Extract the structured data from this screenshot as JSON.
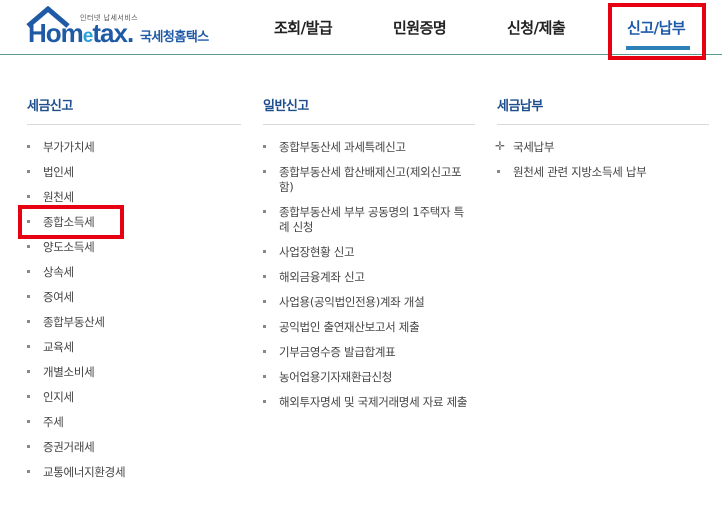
{
  "logo": {
    "sub": "인터넷 납세서비스",
    "word_a": "Hom",
    "word_e": "e",
    "word_b": "tax.",
    "korean": "국세청홈택스"
  },
  "nav": [
    {
      "label": "조회/발급"
    },
    {
      "label": "민원증명"
    },
    {
      "label": "신청/제출"
    },
    {
      "label": "신고/납부"
    }
  ],
  "columns": {
    "tax_report": {
      "title": "세금신고",
      "items": [
        "부가가치세",
        "법인세",
        "원천세",
        "종합소득세",
        "양도소득세",
        "상속세",
        "증여세",
        "종합부동산세",
        "교육세",
        "개별소비세",
        "인지세",
        "주세",
        "증권거래세",
        "교통에너지환경세"
      ]
    },
    "general_report": {
      "title": "일반신고",
      "items": [
        "종합부동산세 과세특례신고",
        "종합부동산세 합산배제신고(제외신고포함)",
        "종합부동산세 부부 공동명의 1주택자 특례 신청",
        "사업장현황 신고",
        "해외금융계좌 신고",
        "사업용(공익법인전용)계좌 개설",
        "공익법인 출연재산보고서 제출",
        "기부금영수증 발급합계표",
        "농어업용기자재환급신청",
        "해외투자명세 및 국제거래명세 자료 제출"
      ]
    },
    "tax_payment": {
      "title": "세금납부",
      "items": [
        "국세납부",
        "원천세 관련 지방소득세 납부"
      ]
    }
  }
}
